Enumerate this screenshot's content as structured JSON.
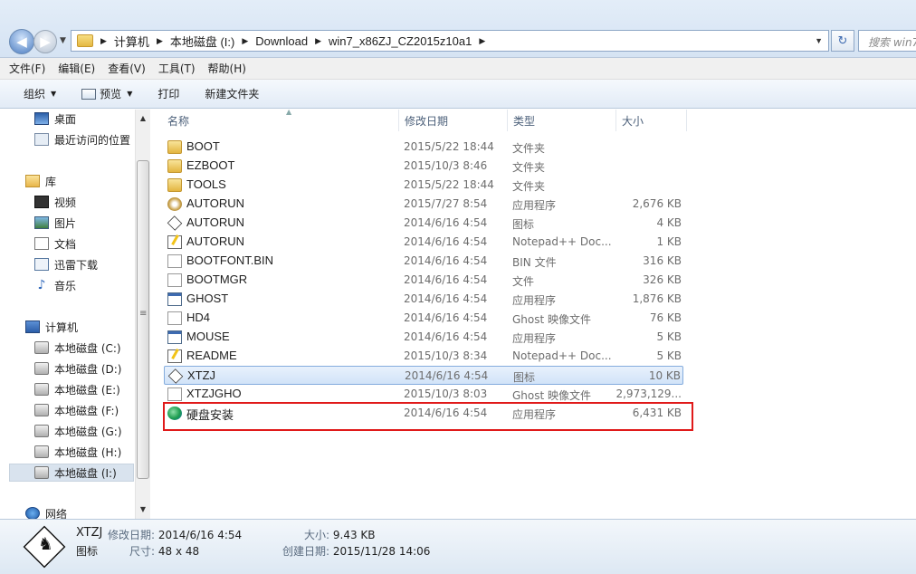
{
  "address": {
    "crumbs": [
      "计算机",
      "本地磁盘 (I:)",
      "Download",
      "win7_x86ZJ_CZ2015z10a1"
    ],
    "search_placeholder": "搜索 win7"
  },
  "menu": [
    "文件(F)",
    "编辑(E)",
    "查看(V)",
    "工具(T)",
    "帮助(H)"
  ],
  "toolbar": {
    "organize": "组织",
    "preview": "预览",
    "print": "打印",
    "new_folder": "新建文件夹"
  },
  "nav": {
    "favorites": [
      {
        "label": "桌面",
        "icon": "desktop-icon"
      },
      {
        "label": "最近访问的位置",
        "icon": "recent-places-icon"
      }
    ],
    "library": {
      "label": "库",
      "icon": "library-icon"
    },
    "library_items": [
      {
        "label": "视频",
        "icon": "video-icon"
      },
      {
        "label": "图片",
        "icon": "picture-icon"
      },
      {
        "label": "文档",
        "icon": "document-icon"
      },
      {
        "label": "迅雷下载",
        "icon": "download-folder-icon"
      },
      {
        "label": "音乐",
        "icon": "music-icon"
      }
    ],
    "computer": {
      "label": "计算机",
      "icon": "computer-icon"
    },
    "drives": [
      {
        "label": "本地磁盘 (C:)"
      },
      {
        "label": "本地磁盘 (D:)"
      },
      {
        "label": "本地磁盘 (E:)"
      },
      {
        "label": "本地磁盘 (F:)"
      },
      {
        "label": "本地磁盘 (G:)"
      },
      {
        "label": "本地磁盘 (H:)"
      },
      {
        "label": "本地磁盘 (I:)"
      }
    ],
    "network": {
      "label": "网络",
      "icon": "network-icon"
    }
  },
  "columns": {
    "name": "名称",
    "date": "修改日期",
    "type": "类型",
    "size": "大小"
  },
  "files": [
    {
      "name": "BOOT",
      "date": "2015/5/22 18:44",
      "type": "文件夹",
      "size": "",
      "icon": "folder"
    },
    {
      "name": "EZBOOT",
      "date": "2015/10/3 8:46",
      "type": "文件夹",
      "size": "",
      "icon": "folder"
    },
    {
      "name": "TOOLS",
      "date": "2015/5/22 18:44",
      "type": "文件夹",
      "size": "",
      "icon": "folder"
    },
    {
      "name": "AUTORUN",
      "date": "2015/7/27 8:54",
      "type": "应用程序",
      "size": "2,676 KB",
      "icon": "exe"
    },
    {
      "name": "AUTORUN",
      "date": "2014/6/16 4:54",
      "type": "图标",
      "size": "4 KB",
      "icon": "ico"
    },
    {
      "name": "AUTORUN",
      "date": "2014/6/16 4:54",
      "type": "Notepad++ Doc...",
      "size": "1 KB",
      "icon": "note"
    },
    {
      "name": "BOOTFONT.BIN",
      "date": "2014/6/16 4:54",
      "type": "BIN 文件",
      "size": "316 KB",
      "icon": "blank"
    },
    {
      "name": "BOOTMGR",
      "date": "2014/6/16 4:54",
      "type": "文件",
      "size": "326 KB",
      "icon": "blank"
    },
    {
      "name": "GHOST",
      "date": "2014/6/16 4:54",
      "type": "应用程序",
      "size": "1,876 KB",
      "icon": "app"
    },
    {
      "name": "HD4",
      "date": "2014/6/16 4:54",
      "type": "Ghost 映像文件",
      "size": "76 KB",
      "icon": "ghost"
    },
    {
      "name": "MOUSE",
      "date": "2014/6/16 4:54",
      "type": "应用程序",
      "size": "5 KB",
      "icon": "app"
    },
    {
      "name": "README",
      "date": "2015/10/3 8:34",
      "type": "Notepad++ Doc...",
      "size": "5 KB",
      "icon": "note"
    },
    {
      "name": "XTZJ",
      "date": "2014/6/16 4:54",
      "type": "图标",
      "size": "10 KB",
      "icon": "ico",
      "selected": true
    },
    {
      "name": "XTZJGHO",
      "date": "2015/10/3 8:03",
      "type": "Ghost 映像文件",
      "size": "2,973,129...",
      "icon": "ghost"
    },
    {
      "name": "硬盘安装",
      "date": "2014/6/16 4:54",
      "type": "应用程序",
      "size": "6,431 KB",
      "icon": "disc"
    }
  ],
  "details": {
    "name": "XTZJ",
    "type": "图标",
    "modified_label": "修改日期:",
    "modified": "2014/6/16 4:54",
    "size_label": "大小:",
    "size": "9.43 KB",
    "dims_label": "尺寸:",
    "dims": "48 x 48",
    "created_label": "创建日期:",
    "created": "2015/11/28 14:06"
  },
  "colors": {
    "highlight_box": "#e01a1a",
    "selection": "#d1e3f8"
  }
}
